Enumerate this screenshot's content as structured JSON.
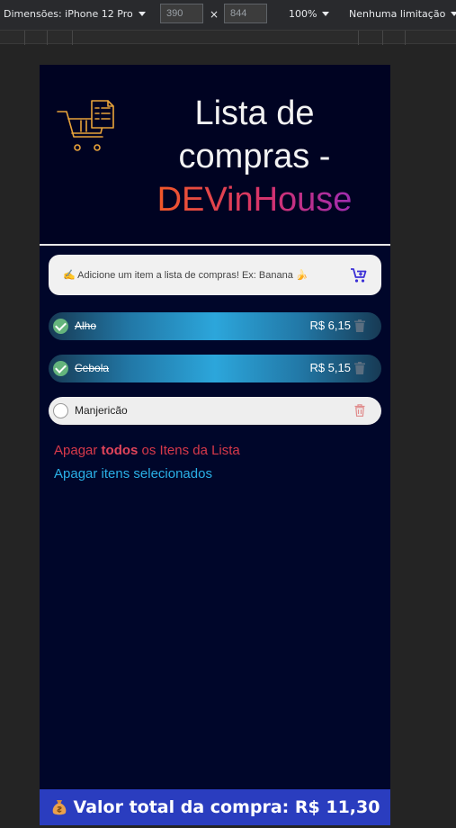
{
  "devtools": {
    "device_label": "Dimensões: iPhone 12 Pro",
    "width_value": "390",
    "times": "×",
    "height_value": "844",
    "zoom_label": "100%",
    "throttle_label": "Nenhuma limitação"
  },
  "header": {
    "title_line1": "Lista de",
    "title_line2": "compras -",
    "title_brand": "DEVinHouse",
    "logo_icon": "shopping-cart-list-icon"
  },
  "add_item": {
    "placeholder": "✍️ Adicione um item a lista de compras! Ex: Banana 🍌",
    "button_icon": "add-to-cart-icon"
  },
  "items": [
    {
      "name": "Alho",
      "price": "R$ 6,15",
      "checked": true
    },
    {
      "name": "Cebola",
      "price": "R$ 5,15",
      "checked": true
    },
    {
      "name": "Manjericão",
      "price": "",
      "checked": false
    }
  ],
  "actions": {
    "delete_all_prefix": "Apagar ",
    "delete_all_bold": "todos",
    "delete_all_suffix": " os Itens da Lista",
    "delete_selected": "Apagar itens selecionados"
  },
  "total": {
    "label": "Valor total da compra: R$ 11,30",
    "icon": "money-bag-icon"
  },
  "colors": {
    "page_bg": "#00062a",
    "total_bar": "#2a3dbf",
    "checked_row_accent": "#2ca6db",
    "danger": "#d8394a",
    "link": "#2ab0e6"
  }
}
